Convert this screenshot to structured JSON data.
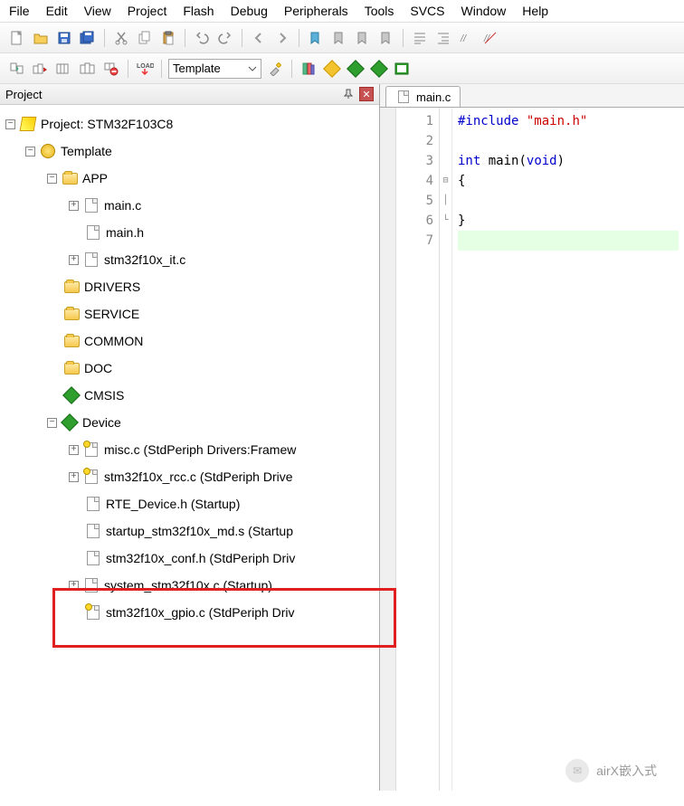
{
  "menu": [
    "File",
    "Edit",
    "View",
    "Project",
    "Flash",
    "Debug",
    "Peripherals",
    "Tools",
    "SVCS",
    "Window",
    "Help"
  ],
  "toolbar2": {
    "combo_label": "Template"
  },
  "panel": {
    "title": "Project",
    "root": "Project: STM32F103C8",
    "target": "Template",
    "app": {
      "label": "APP",
      "files": [
        "main.c",
        "main.h",
        "stm32f10x_it.c"
      ]
    },
    "folders": [
      "DRIVERS",
      "SERVICE",
      "COMMON",
      "DOC"
    ],
    "cmsis": "CMSIS",
    "device": {
      "label": "Device",
      "files": [
        "misc.c (StdPeriph Drivers:Framew",
        "stm32f10x_rcc.c (StdPeriph Drive",
        "RTE_Device.h (Startup)",
        "startup_stm32f10x_md.s (Startup",
        "stm32f10x_conf.h (StdPeriph Driv",
        "system_stm32f10x.c (Startup)",
        "stm32f10x_gpio.c (StdPeriph Driv"
      ]
    }
  },
  "editor": {
    "tab": "main.c",
    "lines": [
      "1",
      "2",
      "3",
      "4",
      "5",
      "6",
      "7"
    ],
    "code": {
      "l1_a": "#include",
      "l1_b": "\"main.h\"",
      "l3_a": "int",
      "l3_b": "main",
      "l3_c": "void",
      "l4": "{",
      "l6": "}"
    }
  },
  "watermark": "airX嵌入式"
}
